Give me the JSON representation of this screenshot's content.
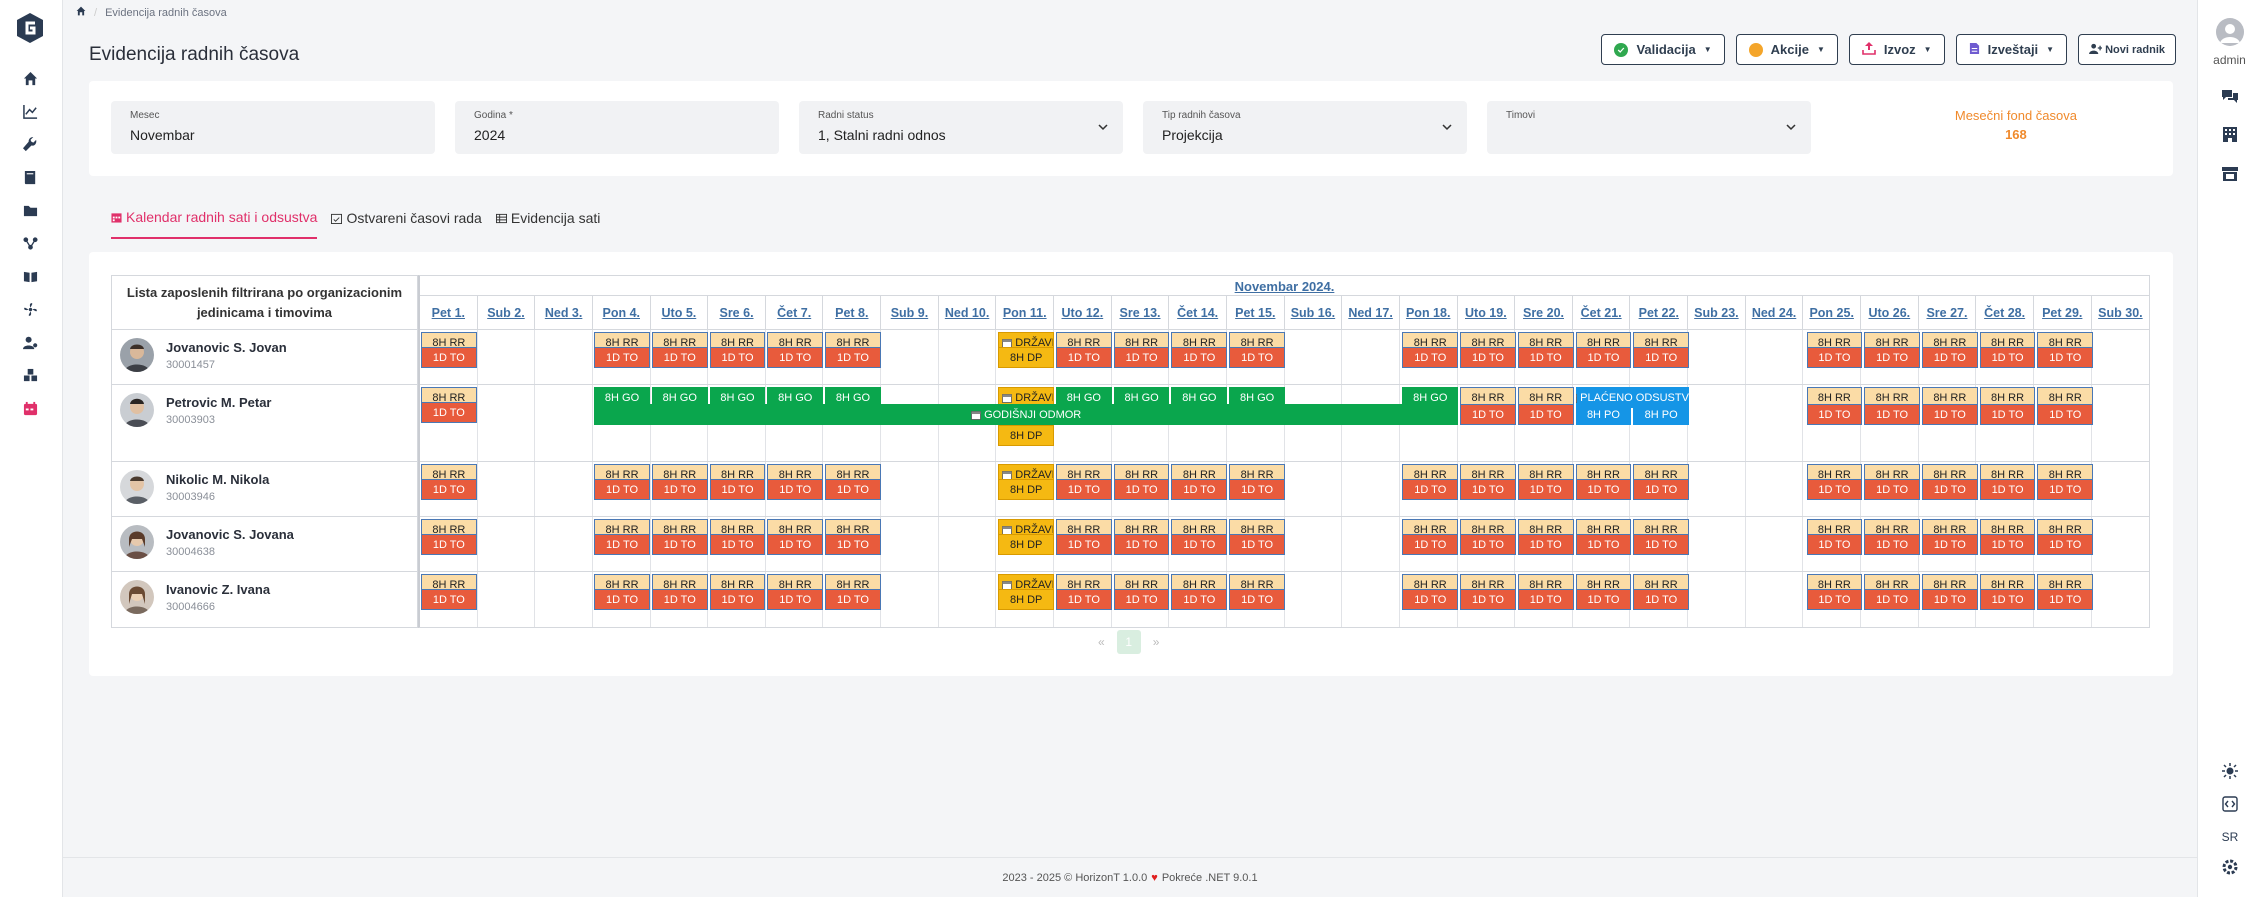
{
  "breadcrumb": {
    "current": "Evidencija radnih časova"
  },
  "page": {
    "title": "Evidencija radnih časova"
  },
  "toolbar": {
    "validacija": "Validacija",
    "akcije": "Akcije",
    "izvoz": "Izvoz",
    "izvestaji": "Izveštaji",
    "novi_radnik": "Novi radnik"
  },
  "filters": {
    "mesec": {
      "label": "Mesec",
      "value": "Novembar"
    },
    "godina": {
      "label": "Godina *",
      "value": "2024"
    },
    "radni_status": {
      "label": "Radni status",
      "value": "1, Stalni radni odnos"
    },
    "tip": {
      "label": "Tip radnih časova",
      "value": "Projekcija"
    },
    "timovi": {
      "label": "Timovi",
      "value": ""
    }
  },
  "fond": {
    "label": "Mesečni fond časova",
    "value": "168"
  },
  "tabs": [
    {
      "label": "Kalendar radnih sati i odsustva"
    },
    {
      "label": "Ostvareni časovi rada"
    },
    {
      "label": "Evidencija sati"
    }
  ],
  "table": {
    "employee_header": "Lista zaposlenih filtrirana po organizacionim jedinicama i timovima",
    "month": "Novembar 2024.",
    "days": [
      "Pet 1.",
      "Sub 2.",
      "Ned 3.",
      "Pon 4.",
      "Uto 5.",
      "Sre 6.",
      "Čet 7.",
      "Pet 8.",
      "Sub 9.",
      "Ned 10.",
      "Pon 11.",
      "Uto 12.",
      "Sre 13.",
      "Čet 14.",
      "Pet 15.",
      "Sub 16.",
      "Ned 17.",
      "Pon 18.",
      "Uto 19.",
      "Sre 20.",
      "Čet 21.",
      "Pet 22.",
      "Sub 23.",
      "Ned 24.",
      "Pon 25.",
      "Uto 26.",
      "Sre 27.",
      "Čet 28.",
      "Pet 29.",
      "Sub 30."
    ]
  },
  "labels": {
    "rr": "8H RR",
    "to": "1D TO",
    "dp": "8H DP",
    "drzavni": "DRŽAVNI PRAZNIK",
    "go": "8H GO",
    "godisnji": "GODIŠNJI ODMOR",
    "placeno": "PLAĆENO ODSUSTVO",
    "po": "8H PO"
  },
  "employees": [
    {
      "name": "Jovanovic S. Jovan",
      "id": "30001457"
    },
    {
      "name": "Petrovic M. Petar",
      "id": "30003903"
    },
    {
      "name": "Nikolic M. Nikola",
      "id": "30003946"
    },
    {
      "name": "Jovanovic S. Jovana",
      "id": "30004638"
    },
    {
      "name": "Ivanovic Z. Ivana",
      "id": "30004666"
    }
  ],
  "pager": {
    "prev": "«",
    "page": "1",
    "next": "»"
  },
  "footer": {
    "text": "2023 - 2025 © HorizonT 1.0.0",
    "powered": "Pokreće .NET 9.0.1"
  },
  "rightbar": {
    "admin": "admin",
    "lang": "SR"
  },
  "colors": {
    "accent": "#e0306a",
    "rr": "#fbdca6",
    "to": "#e85b3c",
    "go": "#0aa64d",
    "dp": "#f5b912",
    "po": "#1595e6",
    "fond": "#f08a2c"
  }
}
